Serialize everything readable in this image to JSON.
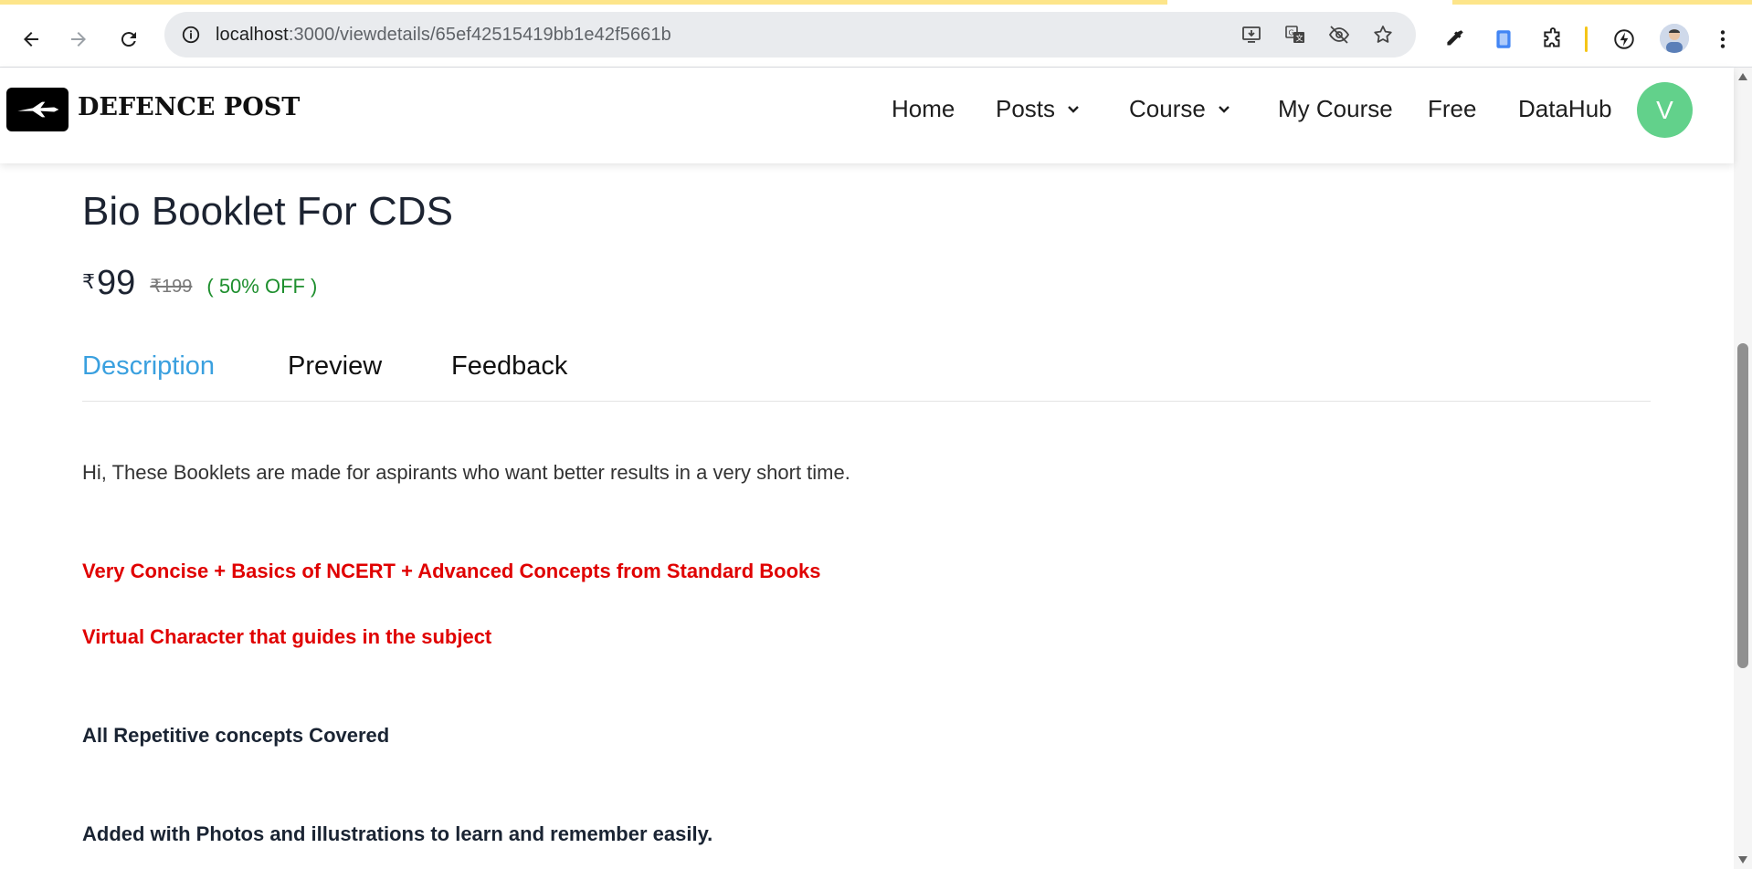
{
  "browser": {
    "url_host": "localhost",
    "url_path": ":3000/viewdetails/65ef42515419bb1e42f5661b",
    "icons": {
      "back": "back-arrow-icon",
      "forward": "forward-arrow-icon",
      "reload": "reload-icon",
      "site_info": "site-info-icon",
      "install": "install-app-icon",
      "translate": "translate-icon",
      "eye_off": "eye-off-icon",
      "bookmark": "star-icon",
      "eyedropper": "eyedropper-icon",
      "extension1": "extension-app-icon",
      "extensions": "puzzle-icon",
      "speed": "lightning-icon",
      "menu": "kebab-menu-icon"
    }
  },
  "site": {
    "brand": "DEFENCE POST",
    "nav": {
      "home": "Home",
      "posts": "Posts",
      "course": "Course",
      "my_course": "My Course",
      "free": "Free",
      "datahub": "DataHub"
    },
    "avatar_letter": "V",
    "avatar_color": "#62d18b"
  },
  "product": {
    "title": "Bio Booklet For CDS",
    "currency": "₹",
    "price": "99",
    "old_price": "₹199",
    "discount": "( 50% OFF )"
  },
  "tabs": {
    "description": "Description",
    "preview": "Preview",
    "feedback": "Feedback",
    "active": "description"
  },
  "description": {
    "intro": "Hi, These Booklets are made for aspirants who want better results in a very short time.",
    "highlight1": "Very Concise + Basics of NCERT + Advanced Concepts from Standard Books",
    "highlight2": "Virtual Character that guides in the subject",
    "point1": "All Repetitive concepts Covered",
    "point2": "Added with Photos and illustrations to learn and remember easily."
  },
  "colors": {
    "accent": "#3aa0df",
    "discount": "#1e8f2e",
    "highlight": "#e00000"
  }
}
